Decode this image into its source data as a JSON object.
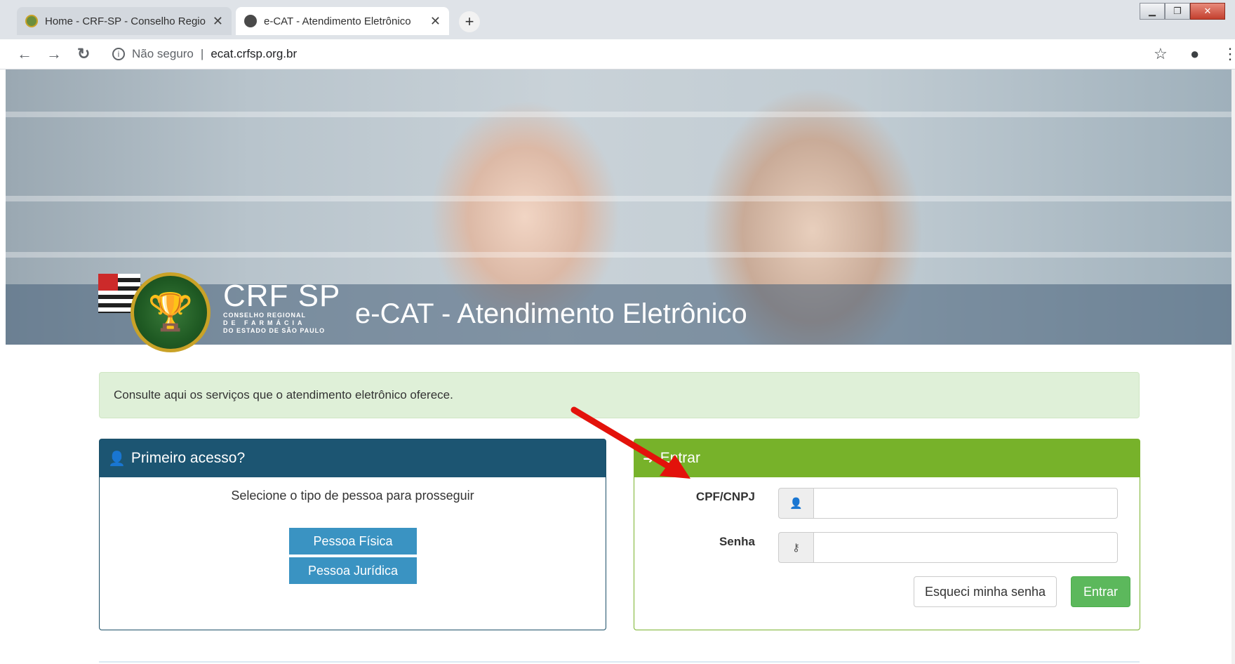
{
  "browser": {
    "tabs": [
      {
        "title": "Home - CRF-SP - Conselho Regio",
        "active": false
      },
      {
        "title": "e-CAT - Atendimento Eletrônico",
        "active": true
      }
    ],
    "new_tab_label": "+",
    "address": {
      "security_label": "Não seguro",
      "url": "ecat.crfsp.org.br"
    }
  },
  "hero": {
    "logo_brand": "CRF SP",
    "logo_line1": "CONSELHO REGIONAL",
    "logo_line2": "DE FARMÁCIA",
    "logo_line3": "DO ESTADO DE SÃO PAULO",
    "title": "e-CAT - Atendimento Eletrônico"
  },
  "alert": {
    "text": "Consulte aqui os serviços que o atendimento eletrônico oferece."
  },
  "first_access": {
    "title": "Primeiro acesso?",
    "prompt": "Selecione o tipo de pessoa para prosseguir",
    "buttons": {
      "fisica": "Pessoa Física",
      "juridica": "Pessoa Jurídica"
    }
  },
  "login": {
    "title": "Entrar",
    "cpf_label": "CPF/CNPJ",
    "password_label": "Senha",
    "cpf_value": "",
    "password_value": "",
    "forgot_label": "Esqueci minha senha",
    "submit_label": "Entrar"
  },
  "colors": {
    "first_access_header": "#1c5572",
    "login_header": "#77b22a",
    "person_button": "#3a93c2",
    "enter_button": "#5cb85c",
    "alert_bg": "#dff0d8",
    "annotation_arrow": "#e3120b"
  }
}
